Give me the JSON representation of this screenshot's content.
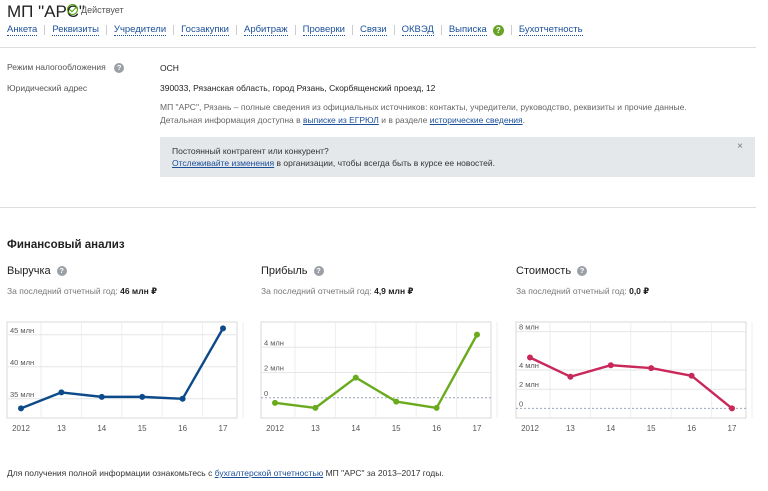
{
  "company": {
    "name": "МП \"АРС\"",
    "status": "Действует"
  },
  "nav": [
    "Анкета",
    "Реквизиты",
    "Учредители",
    "Госзакупки",
    "Арбитраж",
    "Проверки",
    "Связи",
    "ОКВЭД",
    "Выписка",
    "Бухотчетность"
  ],
  "details": {
    "tax_label": "Режим налогообложения",
    "tax_value": "ОСН",
    "address_label": "Юридический адрес",
    "address_value": "390033, Рязанская область, город Рязань, Скорбященский проезд, 12"
  },
  "description": {
    "text1": "МП \"АРС\", Рязань – полные сведения из официальных источников: контакты, учредители, руководство, реквизиты и прочие данные. Детальная информация доступна в ",
    "link1": "выписке из ЕГРЮЛ",
    "text2": " и в разделе ",
    "link2": "исторические сведения",
    "text3": "."
  },
  "notice": {
    "title": "Постоянный контрагент или конкурент?",
    "link": "Отслеживайте изменения",
    "text": " в организации, чтобы всегда быть в курсе ее новостей.",
    "close": "×"
  },
  "finance": {
    "section_title": "Финансовый анализ",
    "subtitle_prefix": "За последний отчетный год:"
  },
  "colors": {
    "revenue": "#0d4a8a",
    "profit": "#6aab1e",
    "cost": "#c8285a",
    "link": "#1a4f99"
  },
  "chart_data": [
    {
      "type": "line",
      "title": "Выручка",
      "last_value": "46 млн ₽",
      "categories": [
        "2012",
        "13",
        "14",
        "15",
        "16",
        "17"
      ],
      "values": [
        33.5,
        36,
        35.3,
        35.3,
        35,
        46
      ],
      "ylim": [
        32,
        47
      ],
      "yticks": [
        {
          "v": 45,
          "label": "45 млн"
        },
        {
          "v": 40,
          "label": "40 млн"
        },
        {
          "v": 35,
          "label": "35 млн"
        }
      ],
      "grid": true
    },
    {
      "type": "line",
      "title": "Прибыль",
      "last_value": "4,9 млн ₽",
      "categories": [
        "2012",
        "13",
        "14",
        "15",
        "16",
        "17"
      ],
      "values": [
        -0.4,
        -0.8,
        1.6,
        -0.3,
        -0.8,
        5
      ],
      "ylim": [
        -1.6,
        6
      ],
      "yticks": [
        {
          "v": 4,
          "label": "4 млн"
        },
        {
          "v": 2,
          "label": "2 млн"
        },
        {
          "v": 0,
          "label": "0"
        }
      ],
      "grid": true
    },
    {
      "type": "line",
      "title": "Стоимость",
      "last_value": "0,0 ₽",
      "categories": [
        "2012",
        "13",
        "14",
        "15",
        "16",
        "17"
      ],
      "values": [
        5.3,
        3.3,
        4.5,
        4.2,
        3.4,
        0
      ],
      "ylim": [
        -1,
        9
      ],
      "yticks": [
        {
          "v": 8,
          "label": "8 млн"
        },
        {
          "v": 4,
          "label": "4 млн"
        },
        {
          "v": 2,
          "label": "2 млн"
        },
        {
          "v": 0,
          "label": "0"
        }
      ],
      "grid": true
    }
  ],
  "footer": {
    "text1": "Для получения полной информации ознакомьтесь с ",
    "link": "бухгалтерской отчетностью",
    "text2": " МП \"АРС\" за 2013–2017 годы."
  }
}
